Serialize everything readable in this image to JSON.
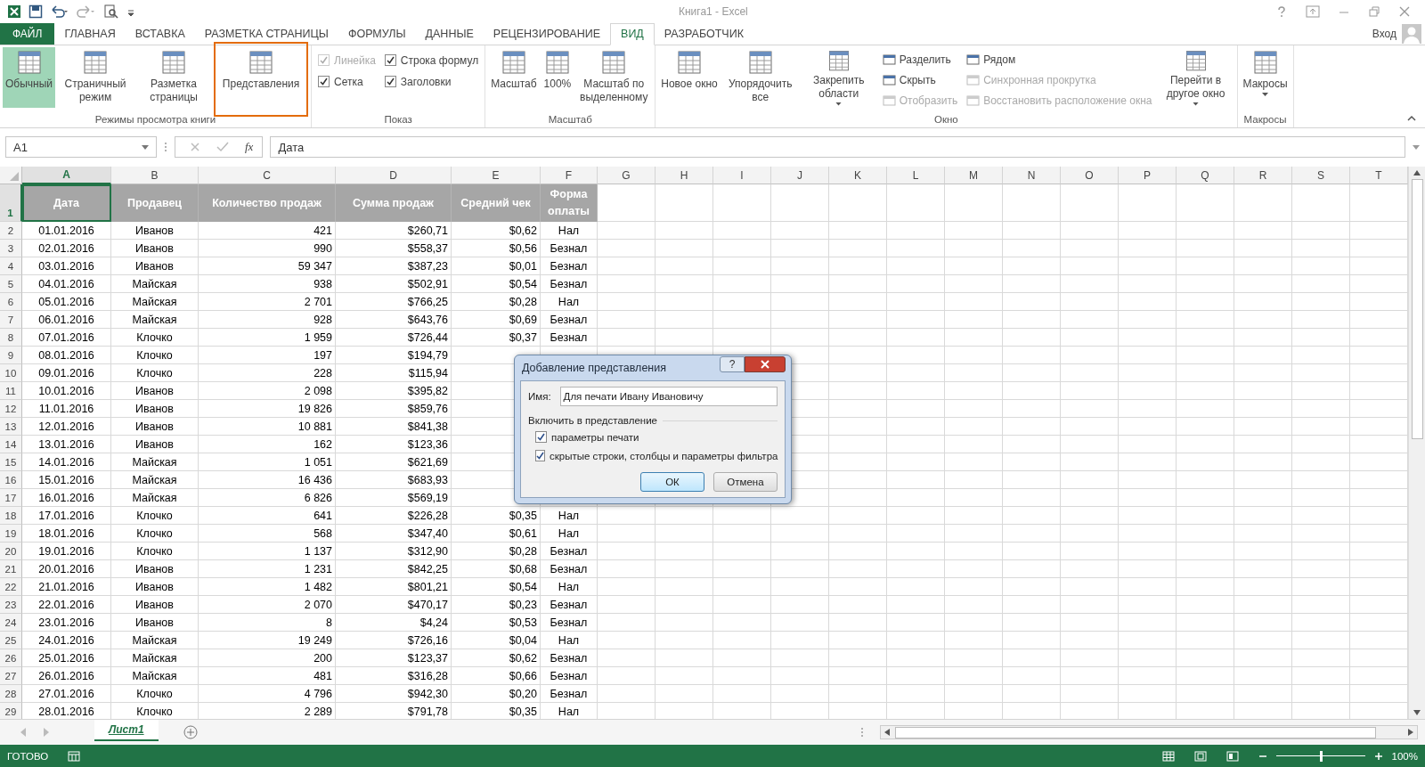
{
  "window": {
    "title": "Книга1 - Excel"
  },
  "tabs": [
    {
      "label": "ФАЙЛ",
      "kind": "file",
      "selected": false
    },
    {
      "label": "ГЛАВНАЯ",
      "kind": "tab",
      "selected": false
    },
    {
      "label": "ВСТАВКА",
      "kind": "tab",
      "selected": false
    },
    {
      "label": "РАЗМЕТКА СТРАНИЦЫ",
      "kind": "tab",
      "selected": false
    },
    {
      "label": "ФОРМУЛЫ",
      "kind": "tab",
      "selected": false
    },
    {
      "label": "ДАННЫЕ",
      "kind": "tab",
      "selected": false
    },
    {
      "label": "РЕЦЕНЗИРОВАНИЕ",
      "kind": "tab",
      "selected": false
    },
    {
      "label": "ВИД",
      "kind": "tab",
      "selected": true
    },
    {
      "label": "РАЗРАБОТЧИК",
      "kind": "tab",
      "selected": false
    }
  ],
  "account": {
    "label": "Вход"
  },
  "ribbon": {
    "groups": [
      {
        "label": "Режимы просмотра книги",
        "items": [
          {
            "kind": "large",
            "label": "Обычный",
            "selected": true,
            "highlighted": false,
            "dropdown": false
          },
          {
            "kind": "large",
            "label": "Страничный режим",
            "selected": false,
            "highlighted": false,
            "dropdown": false
          },
          {
            "kind": "large",
            "label": "Разметка страницы",
            "selected": false,
            "highlighted": false,
            "dropdown": false
          },
          {
            "kind": "large",
            "label": "Представления",
            "selected": false,
            "highlighted": true,
            "dropdown": false
          }
        ]
      },
      {
        "label": "Показ",
        "items": [
          {
            "kind": "stack",
            "items": [
              {
                "kind": "check",
                "label": "Линейка",
                "checked": true,
                "disabled": true
              },
              {
                "kind": "check",
                "label": "Сетка",
                "checked": true,
                "disabled": false
              }
            ]
          },
          {
            "kind": "stack",
            "items": [
              {
                "kind": "check",
                "label": "Строка формул",
                "checked": true,
                "disabled": false
              },
              {
                "kind": "check",
                "label": "Заголовки",
                "checked": true,
                "disabled": false
              }
            ]
          }
        ]
      },
      {
        "label": "Масштаб",
        "items": [
          {
            "kind": "large",
            "label": "Масштаб",
            "selected": false,
            "highlighted": false,
            "dropdown": false
          },
          {
            "kind": "large",
            "label": "100%",
            "selected": false,
            "highlighted": false,
            "dropdown": false
          },
          {
            "kind": "large",
            "label": "Масштаб по выделенному",
            "selected": false,
            "highlighted": false,
            "dropdown": false
          }
        ]
      },
      {
        "label": "Окно",
        "items": [
          {
            "kind": "large",
            "label": "Новое окно",
            "selected": false,
            "highlighted": false,
            "dropdown": false
          },
          {
            "kind": "large",
            "label": "Упорядочить все",
            "selected": false,
            "highlighted": false,
            "dropdown": false
          },
          {
            "kind": "large",
            "label": "Закрепить области",
            "selected": false,
            "highlighted": false,
            "dropdown": true
          },
          {
            "kind": "stack",
            "items": [
              {
                "kind": "small",
                "label": "Разделить",
                "disabled": false
              },
              {
                "kind": "small",
                "label": "Скрыть",
                "disabled": false
              },
              {
                "kind": "small",
                "label": "Отобразить",
                "disabled": true
              }
            ]
          },
          {
            "kind": "stack",
            "items": [
              {
                "kind": "small",
                "label": "Рядом",
                "disabled": false
              },
              {
                "kind": "small",
                "label": "Синхронная прокрутка",
                "disabled": true
              },
              {
                "kind": "small",
                "label": "Восстановить расположение окна",
                "disabled": true
              }
            ]
          },
          {
            "kind": "large",
            "label": "Перейти в другое окно",
            "selected": false,
            "highlighted": false,
            "dropdown": true
          }
        ]
      },
      {
        "label": "Макросы",
        "items": [
          {
            "kind": "large",
            "label": "Макросы",
            "selected": false,
            "highlighted": false,
            "dropdown": true
          }
        ]
      }
    ]
  },
  "formula_bar": {
    "name_box": "A1",
    "fx_label": "fx",
    "formula": "Дата"
  },
  "columns": [
    {
      "label": "A",
      "selected": true
    },
    {
      "label": "B",
      "selected": false
    },
    {
      "label": "C",
      "selected": false
    },
    {
      "label": "D",
      "selected": false
    },
    {
      "label": "E",
      "selected": false
    },
    {
      "label": "F",
      "selected": false
    },
    {
      "label": "G",
      "selected": false
    },
    {
      "label": "H",
      "selected": false
    },
    {
      "label": "I",
      "selected": false
    },
    {
      "label": "J",
      "selected": false
    },
    {
      "label": "K",
      "selected": false
    },
    {
      "label": "L",
      "selected": false
    },
    {
      "label": "M",
      "selected": false
    },
    {
      "label": "N",
      "selected": false
    },
    {
      "label": "O",
      "selected": false
    },
    {
      "label": "P",
      "selected": false
    },
    {
      "label": "Q",
      "selected": false
    },
    {
      "label": "R",
      "selected": false
    },
    {
      "label": "S",
      "selected": false
    },
    {
      "label": "T",
      "selected": false
    }
  ],
  "header_row": {
    "number": "1",
    "selected": true,
    "cells": [
      "Дата",
      "Продавец",
      "Количество продаж",
      "Сумма продаж",
      "Средний чек",
      "Форма оплаты"
    ]
  },
  "rows": [
    {
      "number": "2",
      "cells": [
        "01.01.2016",
        "Иванов",
        "421",
        "$260,71",
        "$0,62",
        "Нал"
      ]
    },
    {
      "number": "3",
      "cells": [
        "02.01.2016",
        "Иванов",
        "990",
        "$558,37",
        "$0,56",
        "Безнал"
      ]
    },
    {
      "number": "4",
      "cells": [
        "03.01.2016",
        "Иванов",
        "59 347",
        "$387,23",
        "$0,01",
        "Безнал"
      ]
    },
    {
      "number": "5",
      "cells": [
        "04.01.2016",
        "Майская",
        "938",
        "$502,91",
        "$0,54",
        "Безнал"
      ]
    },
    {
      "number": "6",
      "cells": [
        "05.01.2016",
        "Майская",
        "2 701",
        "$766,25",
        "$0,28",
        "Нал"
      ]
    },
    {
      "number": "7",
      "cells": [
        "06.01.2016",
        "Майская",
        "928",
        "$643,76",
        "$0,69",
        "Безнал"
      ]
    },
    {
      "number": "8",
      "cells": [
        "07.01.2016",
        "Клочко",
        "1 959",
        "$726,44",
        "$0,37",
        "Безнал"
      ]
    },
    {
      "number": "9",
      "cells": [
        "08.01.2016",
        "Клочко",
        "197",
        "$194,79"
      ]
    },
    {
      "number": "10",
      "cells": [
        "09.01.2016",
        "Клочко",
        "228",
        "$115,94"
      ]
    },
    {
      "number": "11",
      "cells": [
        "10.01.2016",
        "Иванов",
        "2 098",
        "$395,82"
      ]
    },
    {
      "number": "12",
      "cells": [
        "11.01.2016",
        "Иванов",
        "19 826",
        "$859,76"
      ]
    },
    {
      "number": "13",
      "cells": [
        "12.01.2016",
        "Иванов",
        "10 881",
        "$841,38"
      ]
    },
    {
      "number": "14",
      "cells": [
        "13.01.2016",
        "Иванов",
        "162",
        "$123,36"
      ]
    },
    {
      "number": "15",
      "cells": [
        "14.01.2016",
        "Майская",
        "1 051",
        "$621,69"
      ]
    },
    {
      "number": "16",
      "cells": [
        "15.01.2016",
        "Майская",
        "16 436",
        "$683,93"
      ]
    },
    {
      "number": "17",
      "cells": [
        "16.01.2016",
        "Майская",
        "6 826",
        "$569,19"
      ]
    },
    {
      "number": "18",
      "cells": [
        "17.01.2016",
        "Клочко",
        "641",
        "$226,28",
        "$0,35",
        "Нал"
      ]
    },
    {
      "number": "19",
      "cells": [
        "18.01.2016",
        "Клочко",
        "568",
        "$347,40",
        "$0,61",
        "Нал"
      ]
    },
    {
      "number": "20",
      "cells": [
        "19.01.2016",
        "Клочко",
        "1 137",
        "$312,90",
        "$0,28",
        "Безнал"
      ]
    },
    {
      "number": "21",
      "cells": [
        "20.01.2016",
        "Иванов",
        "1 231",
        "$842,25",
        "$0,68",
        "Безнал"
      ]
    },
    {
      "number": "22",
      "cells": [
        "21.01.2016",
        "Иванов",
        "1 482",
        "$801,21",
        "$0,54",
        "Нал"
      ]
    },
    {
      "number": "23",
      "cells": [
        "22.01.2016",
        "Иванов",
        "2 070",
        "$470,17",
        "$0,23",
        "Безнал"
      ]
    },
    {
      "number": "24",
      "cells": [
        "23.01.2016",
        "Иванов",
        "8",
        "$4,24",
        "$0,53",
        "Безнал"
      ]
    },
    {
      "number": "25",
      "cells": [
        "24.01.2016",
        "Майская",
        "19 249",
        "$726,16",
        "$0,04",
        "Нал"
      ]
    },
    {
      "number": "26",
      "cells": [
        "25.01.2016",
        "Майская",
        "200",
        "$123,37",
        "$0,62",
        "Безнал"
      ]
    },
    {
      "number": "27",
      "cells": [
        "26.01.2016",
        "Майская",
        "481",
        "$316,28",
        "$0,66",
        "Безнал"
      ]
    },
    {
      "number": "28",
      "cells": [
        "27.01.2016",
        "Клочко",
        "4 796",
        "$942,30",
        "$0,20",
        "Безнал"
      ]
    },
    {
      "number": "29",
      "cells": [
        "28.01.2016",
        "Клочко",
        "2 289",
        "$791,78",
        "$0,35",
        "Нал"
      ]
    }
  ],
  "sheet_tabs": [
    {
      "label": "Лист1",
      "selected": true
    }
  ],
  "status_bar": {
    "status": "ГОТОВО",
    "zoom": "100%",
    "level": 0.5
  },
  "dialog": {
    "title": "Добавление представления",
    "help": "?",
    "name_label": "Имя:",
    "name_value": "Для печати Ивану Ивановичу",
    "group_label": "Включить в представление",
    "options": [
      {
        "label": "параметры печати",
        "checked": true
      },
      {
        "label": "скрытые строки, столбцы и параметры фильтра",
        "checked": true
      }
    ],
    "buttons": [
      {
        "label": "ОК",
        "kind": "default"
      },
      {
        "label": "Отмена",
        "kind": "normal"
      }
    ]
  }
}
